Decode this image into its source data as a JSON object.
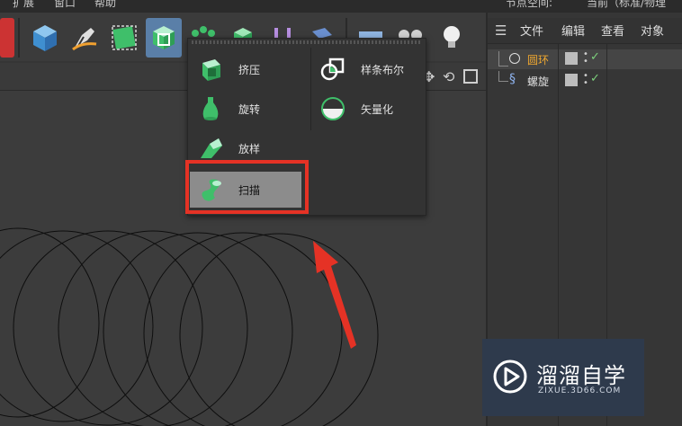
{
  "top_menu": {
    "items": [
      "扩展",
      "窗口",
      "帮助"
    ]
  },
  "right_top": {
    "node_space_label": "节点空间:",
    "node_space_value": "当前（标准/物理"
  },
  "right_panel": {
    "menu": [
      "文件",
      "编辑",
      "查看",
      "对象"
    ],
    "objects": [
      {
        "name": "圆环",
        "icon": "circle-spline-icon",
        "color": "#f0a830",
        "selected": true
      },
      {
        "name": "螺旋",
        "icon": "helix-spline-icon",
        "color": "#e0e0e0",
        "selected": false
      }
    ]
  },
  "generator_menu": {
    "items": [
      {
        "label": "挤压",
        "icon": "extrude-icon"
      },
      {
        "label": "旋转",
        "icon": "lathe-icon"
      },
      {
        "label": "放样",
        "icon": "loft-icon"
      },
      {
        "label": "扫描",
        "icon": "sweep-icon",
        "highlighted": true
      },
      {
        "label": "样条布尔",
        "icon": "spline-boolean-icon"
      },
      {
        "label": "矢量化",
        "icon": "vectorizer-icon"
      }
    ]
  },
  "watermark": {
    "title": "溜溜自学",
    "url": "ZIXUE.3D66.COM"
  },
  "colors": {
    "accent": "#5a7fa8",
    "highlight_box": "#e53225",
    "arrow": "#e53225",
    "menu_highlight": "#8c8c8c",
    "tick": "#7cd07c"
  }
}
